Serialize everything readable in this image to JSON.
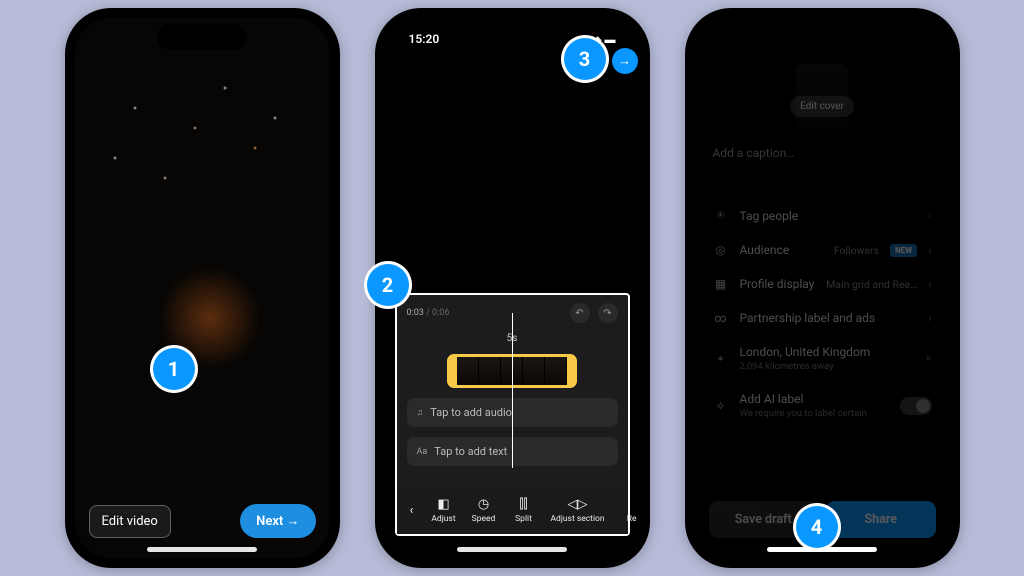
{
  "badges": {
    "b1": "1",
    "b2": "2",
    "b3": "3",
    "b4": "4",
    "arrow": "→"
  },
  "phone1": {
    "edit_video": "Edit video",
    "next": "Next →"
  },
  "phone2": {
    "time": "15:20",
    "elapsed": "0:03",
    "total": "0:06",
    "trim_len": "5s",
    "tap_audio": "Tap to add audio",
    "tap_text": "Tap to add text",
    "tools": {
      "adjust": "Adjust",
      "speed": "Speed",
      "split": "Split",
      "adjust_section": "Adjust section",
      "re": "Re"
    }
  },
  "phone3": {
    "edit_cover": "Edit cover",
    "caption_placeholder": "Add a caption…",
    "options": {
      "tag": "Tag people",
      "audience": "Audience",
      "audience_val": "Followers",
      "audience_new": "NEW",
      "profile": "Profile display",
      "profile_val": "Main grid and Ree…",
      "partnership": "Partnership label and ads",
      "location": "London, United Kingdom",
      "location_sub": "2,094 kilometres away",
      "ailabel": "Add AI label",
      "ailabel_sub": "We require you to label certain"
    },
    "save_draft": "Save draft",
    "share": "Share"
  }
}
